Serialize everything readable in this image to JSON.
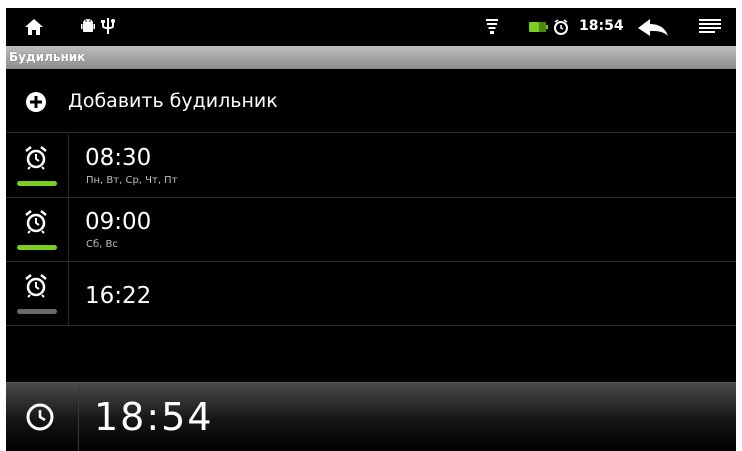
{
  "statusbar": {
    "time": "18:54",
    "icons": [
      "home-icon",
      "android-debug-icon",
      "usb-icon",
      "wifi-icon",
      "battery-icon",
      "alarm-status-icon",
      "back-icon",
      "menu-icon"
    ]
  },
  "titlebar": {
    "title": "Будильник"
  },
  "add_alarm": {
    "label": "Добавить будильник"
  },
  "alarms": [
    {
      "time": "08:30",
      "days": "Пн, Вт, Ср, Чт, Пт",
      "enabled": true
    },
    {
      "time": "09:00",
      "days": "Сб, Вс",
      "enabled": true
    },
    {
      "time": "16:22",
      "days": "",
      "enabled": false
    }
  ],
  "clockbar": {
    "time": "18:54"
  },
  "colors": {
    "enabled": "#7ccf20",
    "disabled": "#6a6a6a",
    "background": "#000000"
  }
}
